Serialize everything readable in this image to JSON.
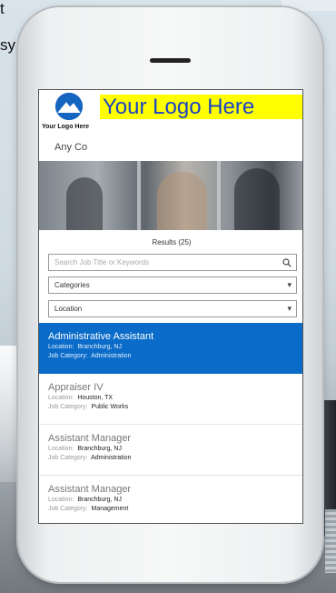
{
  "background": {
    "text_line1": "t",
    "text_line2": "sy"
  },
  "header": {
    "logo_caption": "Your Logo Here",
    "logo_banner": "Your Logo Here",
    "company_name": "Any Co"
  },
  "results_label": "Results (25)",
  "search": {
    "placeholder": "Search Job Title or Keywords",
    "icon": "search-icon"
  },
  "filters": {
    "categories_label": "Categories",
    "location_label": "Location",
    "dropdown_glyph": "▾"
  },
  "jobs": [
    {
      "title": "Administrative Assistant",
      "location_label": "Location:",
      "location": "Branchburg, NJ",
      "category_label": "Job Category:",
      "category": "Administration",
      "selected": true
    },
    {
      "title": "Appraiser IV",
      "location_label": "Location:",
      "location": "Houston, TX",
      "category_label": "Job Category:",
      "category": "Public Works",
      "selected": false
    },
    {
      "title": "Assistant Manager",
      "location_label": "Location:",
      "location": "Branchburg, NJ",
      "category_label": "Job Category:",
      "category": "Administration",
      "selected": false
    },
    {
      "title": "Assistant Manager",
      "location_label": "Location:",
      "location": "Branchburg, NJ",
      "category_label": "Job Category:",
      "category": "Management",
      "selected": false
    }
  ],
  "colors": {
    "selected_row": "#0a6bc8",
    "logo_banner_bg": "#ffff00",
    "logo_banner_text": "#1b43c4"
  }
}
